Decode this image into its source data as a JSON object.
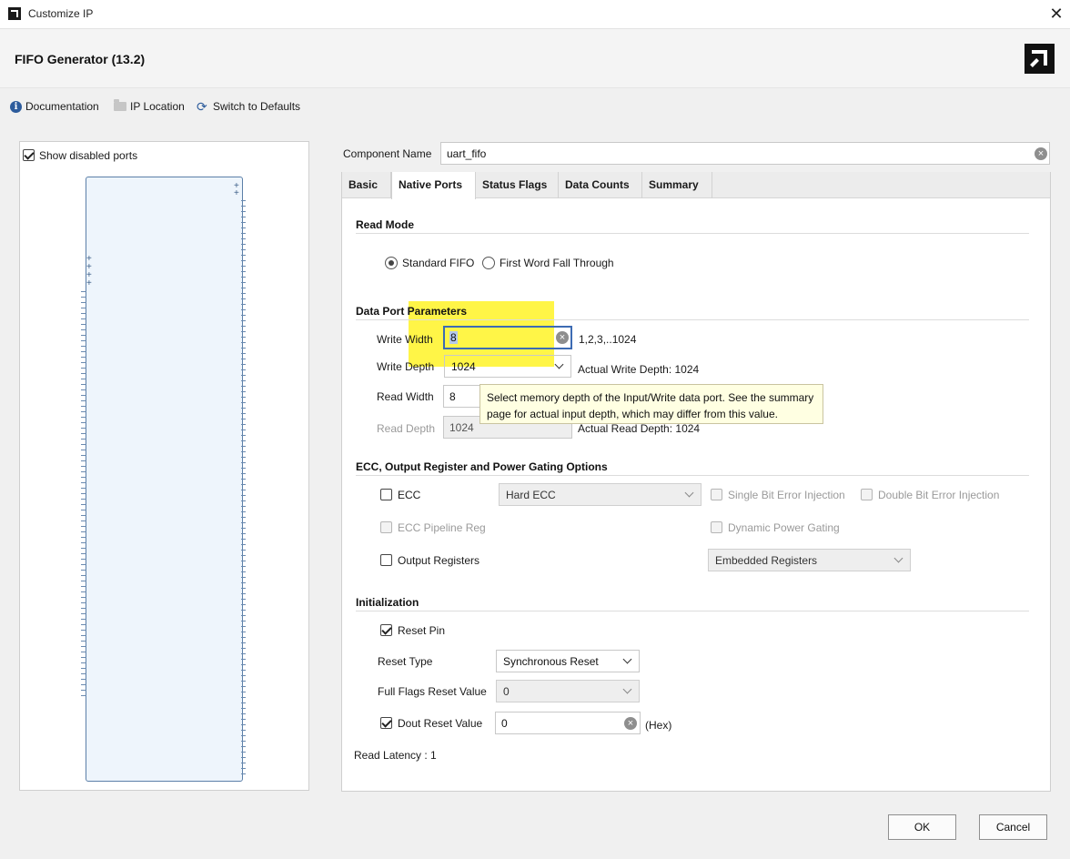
{
  "window": {
    "title": "Customize IP",
    "close_glyph": "✕"
  },
  "header": {
    "title": "FIFO Generator (13.2)",
    "brand_icon": "amd-logo"
  },
  "toolbar": {
    "documentation": "Documentation",
    "ip_location": "IP Location",
    "switch_defaults": "Switch to Defaults"
  },
  "left_panel": {
    "show_disabled_ports": "Show disabled ports",
    "show_disabled_ports_checked": true
  },
  "component": {
    "label": "Component Name",
    "value": "uart_fifo"
  },
  "tabs": [
    {
      "label": "Basic",
      "active": false
    },
    {
      "label": "Native Ports",
      "active": true
    },
    {
      "label": "Status Flags",
      "active": false
    },
    {
      "label": "Data Counts",
      "active": false
    },
    {
      "label": "Summary",
      "active": false
    }
  ],
  "read_mode": {
    "title": "Read Mode",
    "options": [
      "Standard FIFO",
      "First Word Fall Through"
    ],
    "selected": "Standard FIFO"
  },
  "data_port": {
    "title": "Data Port Parameters",
    "write_width_label": "Write Width",
    "write_width_value": "8",
    "write_width_range": "1,2,3,..1024",
    "write_depth_label": "Write Depth",
    "write_depth_value": "1024",
    "actual_write_depth": "Actual Write Depth: 1024",
    "read_width_label": "Read Width",
    "read_width_value": "8",
    "read_depth_label": "Read Depth",
    "read_depth_value": "1024",
    "actual_read_depth": "Actual Read Depth: 1024"
  },
  "tooltip": {
    "line1": "Select memory depth of the Input/Write data port. See the summary",
    "line2": "page for actual input depth, which may differ from this value."
  },
  "ecc": {
    "title": "ECC, Output Register and Power Gating Options",
    "ecc_label": "ECC",
    "ecc_type": "Hard ECC",
    "single_bit": "Single Bit Error Injection",
    "double_bit": "Double Bit Error Injection",
    "ecc_pipeline": "ECC Pipeline Reg",
    "dynamic_power": "Dynamic Power Gating",
    "output_registers": "Output Registers",
    "output_reg_type": "Embedded Registers"
  },
  "init": {
    "title": "Initialization",
    "reset_pin": "Reset Pin",
    "reset_pin_checked": true,
    "reset_type_label": "Reset Type",
    "reset_type_value": "Synchronous Reset",
    "full_flags_label": "Full Flags Reset Value",
    "full_flags_value": "0",
    "dout_reset_label": "Dout Reset Value",
    "dout_reset_checked": true,
    "dout_reset_value": "0",
    "dout_reset_unit": "(Hex)",
    "read_latency": "Read Latency : 1"
  },
  "buttons": {
    "ok": "OK",
    "cancel": "Cancel"
  }
}
